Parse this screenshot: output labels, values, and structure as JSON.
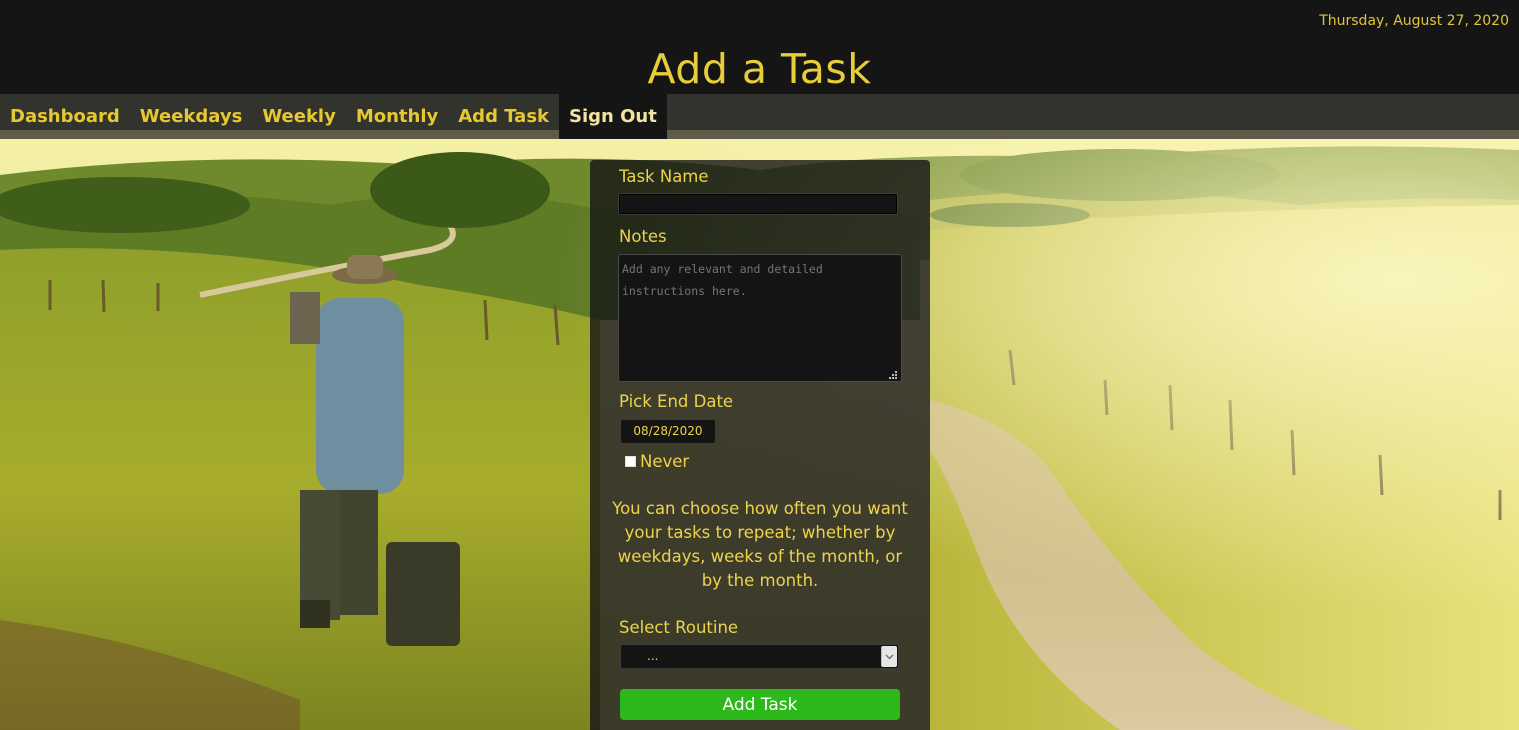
{
  "header": {
    "date": "Thursday, August 27, 2020",
    "title": "Add a Task"
  },
  "nav": {
    "items": [
      {
        "label": "Dashboard"
      },
      {
        "label": "Weekdays"
      },
      {
        "label": "Weekly"
      },
      {
        "label": "Monthly"
      },
      {
        "label": "Add Task"
      },
      {
        "label": "Sign Out"
      }
    ],
    "active_item": "Sign Out"
  },
  "form": {
    "task_name_label": "Task Name",
    "task_name_value": "",
    "notes_label": "Notes",
    "notes_placeholder": "Add any relevant and detailed instructions here.",
    "end_date_label": "Pick End Date",
    "end_date_value": "08/28/2020",
    "never_label": "Never",
    "never_checked": false,
    "info_text": "You can choose how often you want your tasks to repeat; whether by weekdays, weeks of the month, or by the month.",
    "routine_label": "Select Routine",
    "routine_value": "...",
    "submit_label": "Add Task"
  },
  "colors": {
    "accent": "#e8cd3a",
    "header_bg": "#151515",
    "submit_green": "#2db91b"
  },
  "background": {
    "scene": "farmer-on-countryside-road-image"
  }
}
